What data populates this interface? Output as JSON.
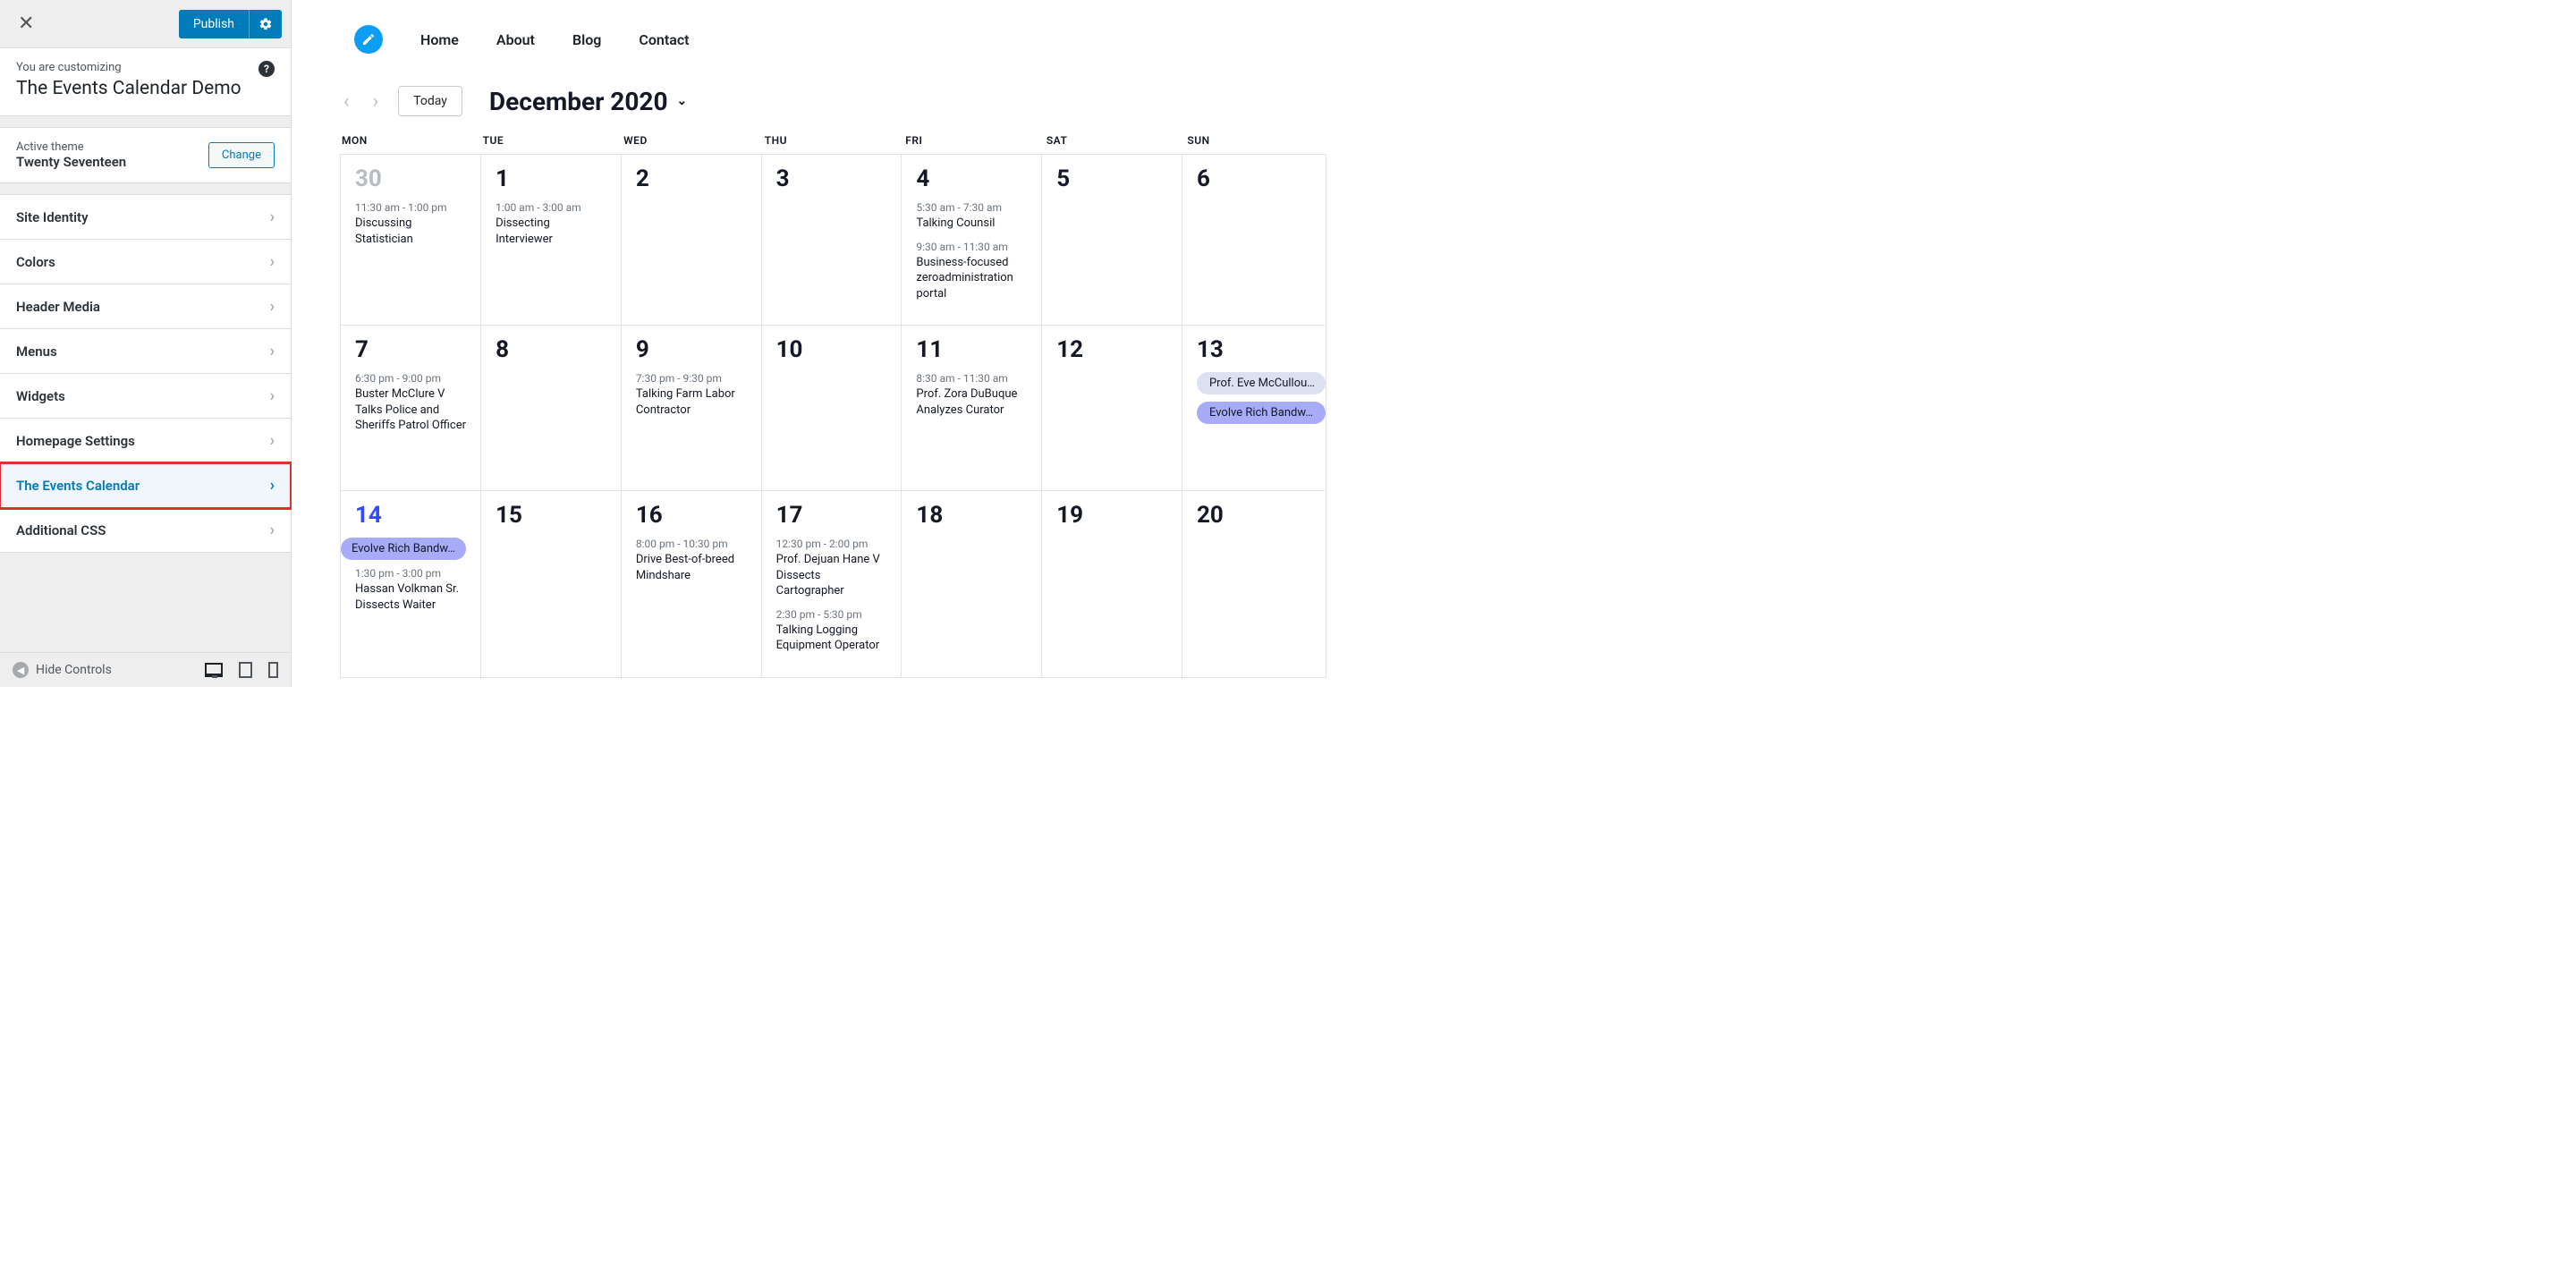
{
  "sidebar": {
    "publish_label": "Publish",
    "customizing_label": "You are customizing",
    "site_title": "The Events Calendar Demo",
    "active_theme_label": "Active theme",
    "theme_name": "Twenty Seventeen",
    "change_label": "Change",
    "menu": [
      {
        "label": "Site Identity"
      },
      {
        "label": "Colors"
      },
      {
        "label": "Header Media"
      },
      {
        "label": "Menus"
      },
      {
        "label": "Widgets"
      },
      {
        "label": "Homepage Settings"
      },
      {
        "label": "The Events Calendar",
        "highlighted": true
      },
      {
        "label": "Additional CSS"
      }
    ],
    "hide_controls_label": "Hide Controls"
  },
  "preview": {
    "nav": [
      "Home",
      "About",
      "Blog",
      "Contact"
    ],
    "today_label": "Today",
    "calendar_title": "December 2020",
    "dow": [
      "MON",
      "TUE",
      "WED",
      "THU",
      "FRI",
      "SAT",
      "SUN"
    ],
    "weeks": [
      [
        {
          "num": "30",
          "prev": true,
          "events": [
            {
              "time": "11:30 am - 1:00 pm",
              "title": "Discussing Statistician"
            }
          ]
        },
        {
          "num": "1",
          "events": [
            {
              "time": "1:00 am - 3:00 am",
              "title": "Dissecting Interviewer"
            }
          ]
        },
        {
          "num": "2",
          "events": []
        },
        {
          "num": "3",
          "events": []
        },
        {
          "num": "4",
          "events": [
            {
              "time": "5:30 am - 7:30 am",
              "title": "Talking Counsil"
            },
            {
              "time": "9:30 am - 11:30 am",
              "title": "Business-focused zeroadministration portal"
            }
          ]
        },
        {
          "num": "5",
          "events": []
        },
        {
          "num": "6",
          "events": []
        }
      ],
      [
        {
          "num": "7",
          "events": [
            {
              "time": "6:30 pm - 9:00 pm",
              "title": "Buster McClure V Talks Police and Sheriffs Patrol Officer"
            }
          ]
        },
        {
          "num": "8",
          "events": []
        },
        {
          "num": "9",
          "events": [
            {
              "time": "7:30 pm - 9:30 pm",
              "title": "Talking Farm Labor Contractor"
            }
          ]
        },
        {
          "num": "10",
          "events": []
        },
        {
          "num": "11",
          "events": [
            {
              "time": "8:30 am - 11:30 am",
              "title": "Prof. Zora DuBuque Analyzes Curator"
            }
          ]
        },
        {
          "num": "12",
          "events": []
        },
        {
          "num": "13",
          "events": [],
          "pills": [
            {
              "text": "Prof. Eve McCullou…",
              "style": "gray rounded-left"
            },
            {
              "text": "Evolve Rich Bandw…",
              "style": "purple rounded-left"
            }
          ]
        }
      ],
      [
        {
          "num": "14",
          "today": true,
          "events": [
            {
              "time": "1:30 pm - 3:00 pm",
              "title": "Hassan Volkman Sr. Dissects Waiter"
            }
          ],
          "pills": [
            {
              "text": "Evolve Rich Bandw…",
              "style": "purple end-right",
              "before_events": true
            }
          ]
        },
        {
          "num": "15",
          "events": []
        },
        {
          "num": "16",
          "events": [
            {
              "time": "8:00 pm - 10:30 pm",
              "title": "Drive Best-of-breed Mindshare"
            }
          ]
        },
        {
          "num": "17",
          "events": [
            {
              "time": "12:30 pm - 2:00 pm",
              "title": "Prof. Dejuan Hane V Dissects Cartographer"
            },
            {
              "time": "2:30 pm - 5:30 pm",
              "title": "Talking Logging Equipment Operator"
            }
          ]
        },
        {
          "num": "18",
          "events": []
        },
        {
          "num": "19",
          "events": []
        },
        {
          "num": "20",
          "events": []
        }
      ]
    ]
  }
}
